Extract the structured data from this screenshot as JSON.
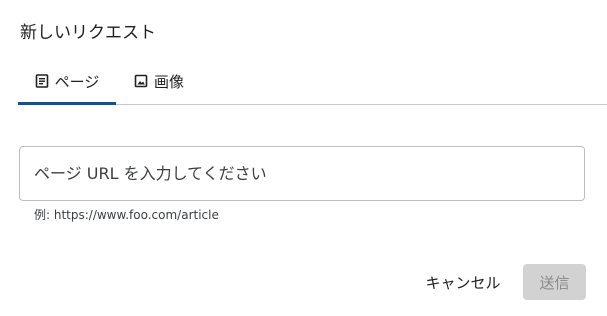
{
  "dialog": {
    "title": "新しいリクエスト"
  },
  "tabs": [
    {
      "label": "ページ",
      "icon": "document-icon",
      "active": true
    },
    {
      "label": "画像",
      "icon": "image-icon",
      "active": false
    }
  ],
  "url_input": {
    "placeholder": "ページ URL を入力してください",
    "value": "",
    "helper": "例: https://www.foo.com/article"
  },
  "actions": {
    "cancel_label": "キャンセル",
    "submit_label": "送信",
    "submit_disabled": true
  },
  "colors": {
    "accent": "#1a4f8f",
    "disabled_button_bg": "#d2d2d2",
    "disabled_button_text": "#8a8a8a",
    "divider": "#c9c9c9"
  }
}
